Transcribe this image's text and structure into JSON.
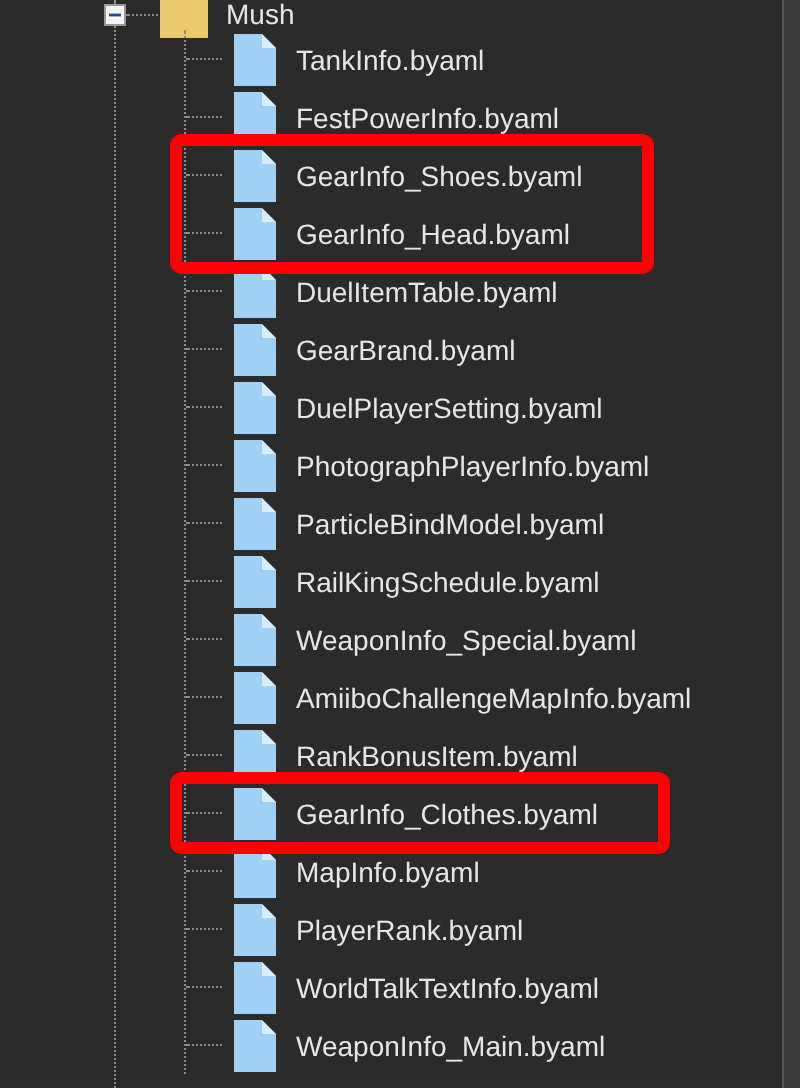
{
  "folder": {
    "name": "Mush",
    "expanded": true
  },
  "files": [
    {
      "name": "TankInfo.byaml",
      "highlighted": false
    },
    {
      "name": "FestPowerInfo.byaml",
      "highlighted": false
    },
    {
      "name": "GearInfo_Shoes.byaml",
      "highlighted": true
    },
    {
      "name": "GearInfo_Head.byaml",
      "highlighted": true
    },
    {
      "name": "DuelItemTable.byaml",
      "highlighted": false
    },
    {
      "name": "GearBrand.byaml",
      "highlighted": false
    },
    {
      "name": "DuelPlayerSetting.byaml",
      "highlighted": false
    },
    {
      "name": "PhotographPlayerInfo.byaml",
      "highlighted": false
    },
    {
      "name": "ParticleBindModel.byaml",
      "highlighted": false
    },
    {
      "name": "RailKingSchedule.byaml",
      "highlighted": false
    },
    {
      "name": "WeaponInfo_Special.byaml",
      "highlighted": false
    },
    {
      "name": "AmiiboChallengeMapInfo.byaml",
      "highlighted": false
    },
    {
      "name": "RankBonusItem.byaml",
      "highlighted": false
    },
    {
      "name": "GearInfo_Clothes.byaml",
      "highlighted": true
    },
    {
      "name": "MapInfo.byaml",
      "highlighted": false
    },
    {
      "name": "PlayerRank.byaml",
      "highlighted": false
    },
    {
      "name": "WorldTalkTextInfo.byaml",
      "highlighted": false
    },
    {
      "name": "WeaponInfo_Main.byaml",
      "highlighted": false
    }
  ]
}
